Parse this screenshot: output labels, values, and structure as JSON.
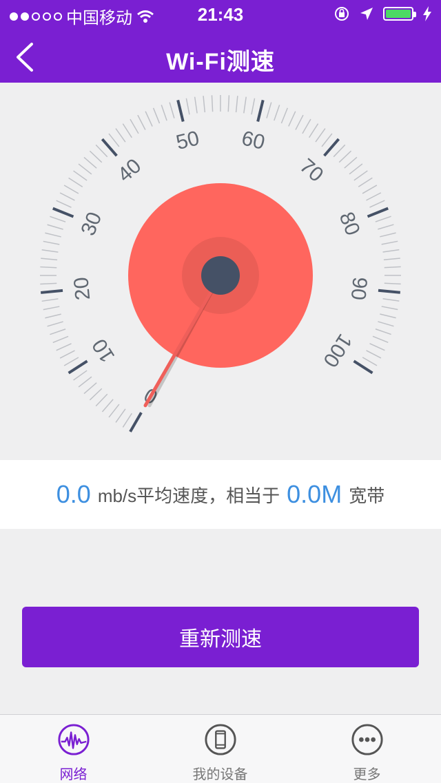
{
  "status_bar": {
    "carrier": "中国移动",
    "time": "21:43"
  },
  "nav": {
    "title": "Wi-Fi测速",
    "back_icon": "chevron-left-icon"
  },
  "gauge": {
    "scale_labels": [
      "0",
      "10",
      "20",
      "30",
      "40",
      "50",
      "60",
      "70",
      "80",
      "90",
      "100"
    ],
    "current_value": 0,
    "needle_color": "#ef5f5a",
    "dial_color": "#ff665e",
    "hub_color": "#455166"
  },
  "result": {
    "speed_value": "0.0",
    "speed_text": "mb/s平均速度，相当于",
    "bandwidth_value": "0.0M",
    "bandwidth_text": "宽带"
  },
  "actions": {
    "retest_label": "重新测速"
  },
  "tabs": [
    {
      "label": "网络",
      "icon": "network-waveform-icon",
      "active": true
    },
    {
      "label": "我的设备",
      "icon": "phone-device-icon",
      "active": false
    },
    {
      "label": "更多",
      "icon": "more-dots-icon",
      "active": false
    }
  ],
  "colors": {
    "accent": "#7a1fd2",
    "value_blue": "#3d8fe0"
  }
}
